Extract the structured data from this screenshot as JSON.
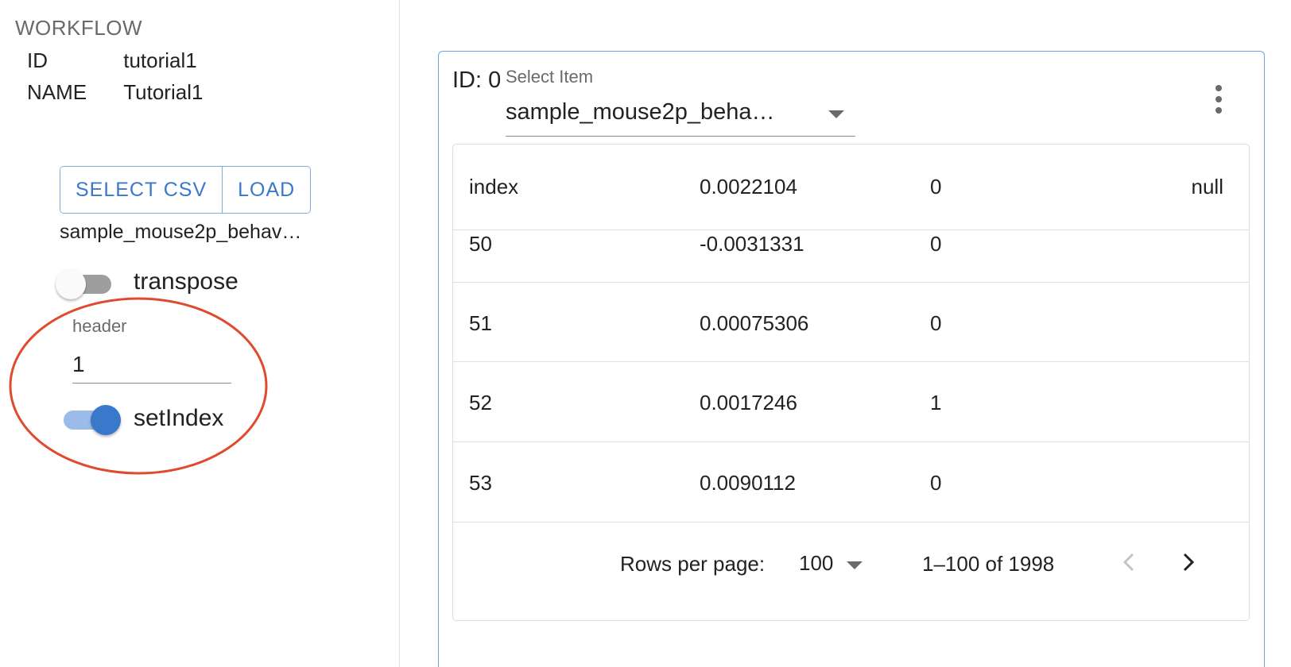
{
  "workflow": {
    "title": "WORKFLOW",
    "id_key": "ID",
    "id_value": "tutorial1",
    "name_key": "NAME",
    "name_value": "Tutorial1"
  },
  "csv": {
    "select_label": "SELECT CSV",
    "load_label": "LOAD",
    "file_name": "sample_mouse2p_behav…",
    "transpose_label": "transpose",
    "transpose_on": false,
    "header_label": "header",
    "header_value": "1",
    "setindex_label": "setIndex",
    "setindex_on": true
  },
  "annotation": {
    "color": "#e04a2e"
  },
  "card": {
    "id_label": "ID: 0",
    "select_label": "Select Item",
    "select_value": "sample_mouse2p_beha…",
    "accent_color": "#3a78cc"
  },
  "table": {
    "header": [
      "index",
      "0.0022104",
      "0",
      "null"
    ],
    "rows": [
      [
        "50",
        "-0.0031331",
        "0"
      ],
      [
        "51",
        "0.00075306",
        "0"
      ],
      [
        "52",
        "0.0017246",
        "1"
      ],
      [
        "53",
        "0.0090112",
        "0"
      ]
    ]
  },
  "pagination": {
    "rows_per_page_label": "Rows per page:",
    "rows_per_page_value": "100",
    "range_text": "1–100 of 1998"
  },
  "icons": {
    "more": "more-vert-icon",
    "prev": "chevron-left-icon",
    "next": "chevron-right-icon",
    "dropdown": "arrow-drop-down-icon"
  }
}
